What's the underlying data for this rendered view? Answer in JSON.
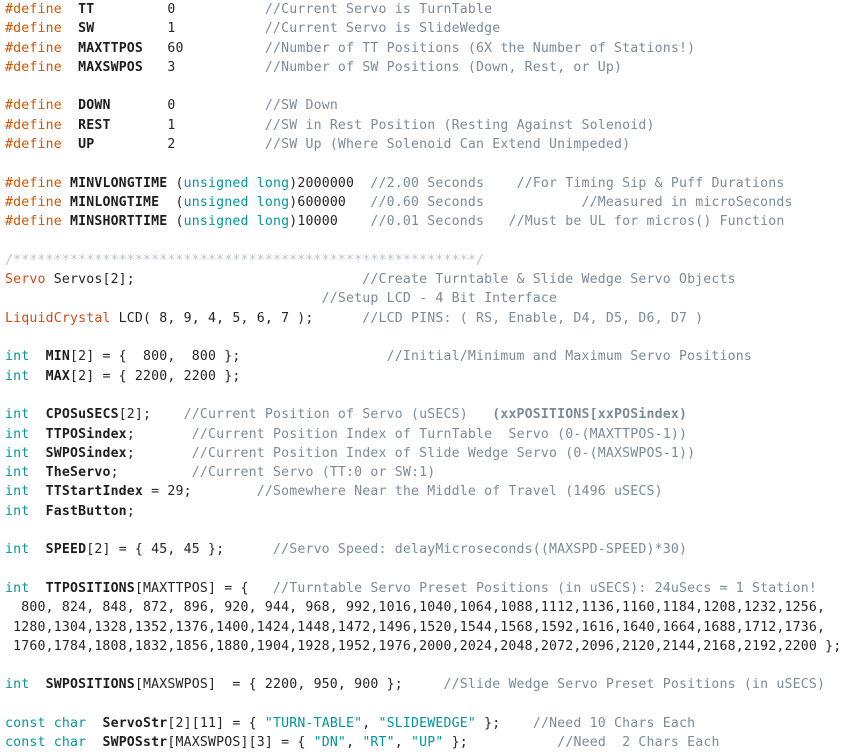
{
  "document": {
    "kind": "source-code-listing",
    "language": "Arduino C++",
    "colors": {
      "background": "#ffffff",
      "preprocessor": "#d35400",
      "type": "#00979c",
      "class": "#cf4b18",
      "string": "#00979c",
      "comment": "#7b8b99",
      "divider": "#b9c4d0",
      "plain": "#252525"
    }
  },
  "lines": [
    {
      "id": "l01",
      "tokens": [
        {
          "t": "pre",
          "v": "#define"
        },
        {
          "t": "plain",
          "v": "  "
        },
        {
          "t": "name",
          "v": "TT"
        },
        {
          "t": "plain",
          "v": "         0           "
        },
        {
          "t": "comment",
          "v": "//Current Servo is TurnTable"
        }
      ]
    },
    {
      "id": "l02",
      "tokens": [
        {
          "t": "pre",
          "v": "#define"
        },
        {
          "t": "plain",
          "v": "  "
        },
        {
          "t": "name",
          "v": "SW"
        },
        {
          "t": "plain",
          "v": "         1           "
        },
        {
          "t": "comment",
          "v": "//Current Servo is SlideWedge"
        }
      ]
    },
    {
      "id": "l03",
      "tokens": [
        {
          "t": "pre",
          "v": "#define"
        },
        {
          "t": "plain",
          "v": "  "
        },
        {
          "t": "name",
          "v": "MAXTTPOS"
        },
        {
          "t": "plain",
          "v": "   60          "
        },
        {
          "t": "comment",
          "v": "//Number of TT Positions (6X the Number of Stations!)"
        }
      ]
    },
    {
      "id": "l04",
      "tokens": [
        {
          "t": "pre",
          "v": "#define"
        },
        {
          "t": "plain",
          "v": "  "
        },
        {
          "t": "name",
          "v": "MAXSWPOS"
        },
        {
          "t": "plain",
          "v": "   3           "
        },
        {
          "t": "comment",
          "v": "//Number of SW Positions (Down, Rest, or Up)"
        }
      ]
    },
    {
      "id": "l05",
      "blank": true,
      "tokens": []
    },
    {
      "id": "l06",
      "tokens": [
        {
          "t": "pre",
          "v": "#define"
        },
        {
          "t": "plain",
          "v": "  "
        },
        {
          "t": "name",
          "v": "DOWN"
        },
        {
          "t": "plain",
          "v": "       0           "
        },
        {
          "t": "comment",
          "v": "//SW Down"
        }
      ]
    },
    {
      "id": "l07",
      "tokens": [
        {
          "t": "pre",
          "v": "#define"
        },
        {
          "t": "plain",
          "v": "  "
        },
        {
          "t": "name",
          "v": "REST"
        },
        {
          "t": "plain",
          "v": "       1           "
        },
        {
          "t": "comment",
          "v": "//SW in Rest Position (Resting Against Solenoid)"
        }
      ]
    },
    {
      "id": "l08",
      "tokens": [
        {
          "t": "pre",
          "v": "#define"
        },
        {
          "t": "plain",
          "v": "  "
        },
        {
          "t": "name",
          "v": "UP"
        },
        {
          "t": "plain",
          "v": "         2           "
        },
        {
          "t": "comment",
          "v": "//SW Up (Where Solenoid Can Extend Unimpeded)"
        }
      ]
    },
    {
      "id": "l09",
      "blank": true,
      "tokens": []
    },
    {
      "id": "l10",
      "tokens": [
        {
          "t": "pre",
          "v": "#define"
        },
        {
          "t": "plain",
          "v": " "
        },
        {
          "t": "name",
          "v": "MINVLONGTIME"
        },
        {
          "t": "plain",
          "v": " ("
        },
        {
          "t": "type",
          "v": "unsigned long"
        },
        {
          "t": "plain",
          "v": ")2000000  "
        },
        {
          "t": "comment",
          "v": "//2.00 Seconds    //For Timing Sip & Puff Durations"
        }
      ]
    },
    {
      "id": "l11",
      "tokens": [
        {
          "t": "pre",
          "v": "#define"
        },
        {
          "t": "plain",
          "v": " "
        },
        {
          "t": "name",
          "v": "MINLONGTIME"
        },
        {
          "t": "plain",
          "v": "  ("
        },
        {
          "t": "type",
          "v": "unsigned long"
        },
        {
          "t": "plain",
          "v": ")600000   "
        },
        {
          "t": "comment",
          "v": "//0.60 Seconds            //Measured in microSeconds"
        }
      ]
    },
    {
      "id": "l12",
      "tokens": [
        {
          "t": "pre",
          "v": "#define"
        },
        {
          "t": "plain",
          "v": " "
        },
        {
          "t": "name",
          "v": "MINSHORTTIME"
        },
        {
          "t": "plain",
          "v": " ("
        },
        {
          "t": "type",
          "v": "unsigned long"
        },
        {
          "t": "plain",
          "v": ")10000    "
        },
        {
          "t": "comment",
          "v": "//0.01 Seconds   //Must be UL for micros() Function"
        }
      ]
    },
    {
      "id": "l13",
      "blank": true,
      "tokens": []
    },
    {
      "id": "l14",
      "tokens": [
        {
          "t": "divider",
          "v": "/*********************************************************/"
        }
      ]
    },
    {
      "id": "l15",
      "tokens": [
        {
          "t": "class",
          "v": "Servo"
        },
        {
          "t": "plain",
          "v": " Servos[2];                            "
        },
        {
          "t": "comment",
          "v": "//Create Turntable & Slide Wedge Servo Objects"
        }
      ]
    },
    {
      "id": "l16",
      "tokens": [
        {
          "t": "plain",
          "v": "                                       "
        },
        {
          "t": "comment",
          "v": "//Setup LCD - 4 Bit Interface"
        }
      ]
    },
    {
      "id": "l17",
      "tokens": [
        {
          "t": "class",
          "v": "LiquidCrystal"
        },
        {
          "t": "plain",
          "v": " LCD( 8, 9, 4, 5, 6, 7 );      "
        },
        {
          "t": "comment",
          "v": "//LCD PINS: ( RS, Enable, D4, D5, D6, D7 )"
        }
      ]
    },
    {
      "id": "l18",
      "blank": true,
      "tokens": []
    },
    {
      "id": "l19",
      "tokens": [
        {
          "t": "type",
          "v": "int"
        },
        {
          "t": "plain",
          "v": "  "
        },
        {
          "t": "name",
          "v": "MIN"
        },
        {
          "t": "plain",
          "v": "[2] = {  800,  800 };                  "
        },
        {
          "t": "comment",
          "v": "//Initial/Minimum and Maximum Servo Positions"
        }
      ]
    },
    {
      "id": "l20",
      "tokens": [
        {
          "t": "type",
          "v": "int"
        },
        {
          "t": "plain",
          "v": "  "
        },
        {
          "t": "name",
          "v": "MAX"
        },
        {
          "t": "plain",
          "v": "[2] = { 2200, 2200 };"
        }
      ]
    },
    {
      "id": "l21",
      "blank": true,
      "tokens": []
    },
    {
      "id": "l22",
      "tokens": [
        {
          "t": "type",
          "v": "int"
        },
        {
          "t": "plain",
          "v": "  "
        },
        {
          "t": "name",
          "v": "CPOSuSECS"
        },
        {
          "t": "plain",
          "v": "[2];    "
        },
        {
          "t": "comment",
          "v": "//Current Position of Servo (uSECS)   "
        },
        {
          "t": "commentb",
          "v": "(xxPOSITIONS[xxPOSindex)"
        }
      ]
    },
    {
      "id": "l23",
      "tokens": [
        {
          "t": "type",
          "v": "int"
        },
        {
          "t": "plain",
          "v": "  "
        },
        {
          "t": "name",
          "v": "TTPOSindex"
        },
        {
          "t": "plain",
          "v": ";       "
        },
        {
          "t": "comment",
          "v": "//Current Position Index of TurnTable  Servo (0-(MAXTTPOS-1))"
        }
      ]
    },
    {
      "id": "l24",
      "tokens": [
        {
          "t": "type",
          "v": "int"
        },
        {
          "t": "plain",
          "v": "  "
        },
        {
          "t": "name",
          "v": "SWPOSindex"
        },
        {
          "t": "plain",
          "v": ";       "
        },
        {
          "t": "comment",
          "v": "//Current Position Index of Slide Wedge Servo (0-(MAXSWPOS-1))"
        }
      ]
    },
    {
      "id": "l25",
      "tokens": [
        {
          "t": "type",
          "v": "int"
        },
        {
          "t": "plain",
          "v": "  "
        },
        {
          "t": "name",
          "v": "TheServo"
        },
        {
          "t": "plain",
          "v": ";         "
        },
        {
          "t": "comment",
          "v": "//Current Servo (TT:0 or SW:1)"
        }
      ]
    },
    {
      "id": "l26",
      "tokens": [
        {
          "t": "type",
          "v": "int"
        },
        {
          "t": "plain",
          "v": "  "
        },
        {
          "t": "name",
          "v": "TTStartIndex"
        },
        {
          "t": "plain",
          "v": " = 29;        "
        },
        {
          "t": "comment",
          "v": "//Somewhere Near the Middle of Travel (1496 uSECS)"
        }
      ]
    },
    {
      "id": "l27",
      "tokens": [
        {
          "t": "type",
          "v": "int"
        },
        {
          "t": "plain",
          "v": "  "
        },
        {
          "t": "name",
          "v": "FastButton"
        },
        {
          "t": "plain",
          "v": ";"
        }
      ]
    },
    {
      "id": "l28",
      "blank": true,
      "tokens": []
    },
    {
      "id": "l29",
      "tokens": [
        {
          "t": "type",
          "v": "int"
        },
        {
          "t": "plain",
          "v": "  "
        },
        {
          "t": "name",
          "v": "SPEED"
        },
        {
          "t": "plain",
          "v": "[2] = { 45, 45 };      "
        },
        {
          "t": "comment",
          "v": "//Servo Speed: delayMicroseconds((MAXSPD-SPEED)*30)"
        }
      ]
    },
    {
      "id": "l30",
      "blank": true,
      "tokens": []
    },
    {
      "id": "l31",
      "tokens": [
        {
          "t": "type",
          "v": "int"
        },
        {
          "t": "plain",
          "v": "  "
        },
        {
          "t": "name",
          "v": "TTPOSITIONS"
        },
        {
          "t": "plain",
          "v": "[MAXTTPOS] = {   "
        },
        {
          "t": "comment",
          "v": "//Turntable Servo Preset Positions (in uSECS): 24uSecs = 1 Station!"
        }
      ]
    },
    {
      "id": "l32",
      "tokens": [
        {
          "t": "plain",
          "v": "  800, 824, 848, 872, 896, 920, 944, 968, 992,1016,1040,1064,1088,1112,1136,1160,1184,1208,1232,1256,"
        }
      ]
    },
    {
      "id": "l33",
      "tokens": [
        {
          "t": "plain",
          "v": " 1280,1304,1328,1352,1376,1400,1424,1448,1472,1496,1520,1544,1568,1592,1616,1640,1664,1688,1712,1736,"
        }
      ]
    },
    {
      "id": "l34",
      "tokens": [
        {
          "t": "plain",
          "v": " 1760,1784,1808,1832,1856,1880,1904,1928,1952,1976,2000,2024,2048,2072,2096,2120,2144,2168,2192,2200 };"
        }
      ]
    },
    {
      "id": "l35",
      "blank": true,
      "tokens": []
    },
    {
      "id": "l36",
      "tokens": [
        {
          "t": "type",
          "v": "int"
        },
        {
          "t": "plain",
          "v": "  "
        },
        {
          "t": "name",
          "v": "SWPOSITIONS"
        },
        {
          "t": "plain",
          "v": "[MAXSWPOS]  = { 2200, 950, 900 };     "
        },
        {
          "t": "comment",
          "v": "//Slide Wedge Servo Preset Positions (in uSECS)"
        }
      ]
    },
    {
      "id": "l37",
      "blank": true,
      "tokens": []
    },
    {
      "id": "l38",
      "tokens": [
        {
          "t": "type",
          "v": "const char"
        },
        {
          "t": "plain",
          "v": "  "
        },
        {
          "t": "name",
          "v": "ServoStr"
        },
        {
          "t": "plain",
          "v": "[2][11] = { "
        },
        {
          "t": "string",
          "v": "\"TURN-TABLE\""
        },
        {
          "t": "plain",
          "v": ", "
        },
        {
          "t": "string",
          "v": "\"SLIDEWEDGE\""
        },
        {
          "t": "plain",
          "v": " };    "
        },
        {
          "t": "comment",
          "v": "//Need 10 Chars Each"
        }
      ]
    },
    {
      "id": "l39",
      "tokens": [
        {
          "t": "type",
          "v": "const char"
        },
        {
          "t": "plain",
          "v": "  "
        },
        {
          "t": "name",
          "v": "SWPOSstr"
        },
        {
          "t": "plain",
          "v": "[MAXSWPOS][3] = { "
        },
        {
          "t": "string",
          "v": "\"DN\""
        },
        {
          "t": "plain",
          "v": ", "
        },
        {
          "t": "string",
          "v": "\"RT\""
        },
        {
          "t": "plain",
          "v": ", "
        },
        {
          "t": "string",
          "v": "\"UP\""
        },
        {
          "t": "plain",
          "v": " };           "
        },
        {
          "t": "comment",
          "v": "//Need  2 Chars Each"
        }
      ]
    }
  ]
}
